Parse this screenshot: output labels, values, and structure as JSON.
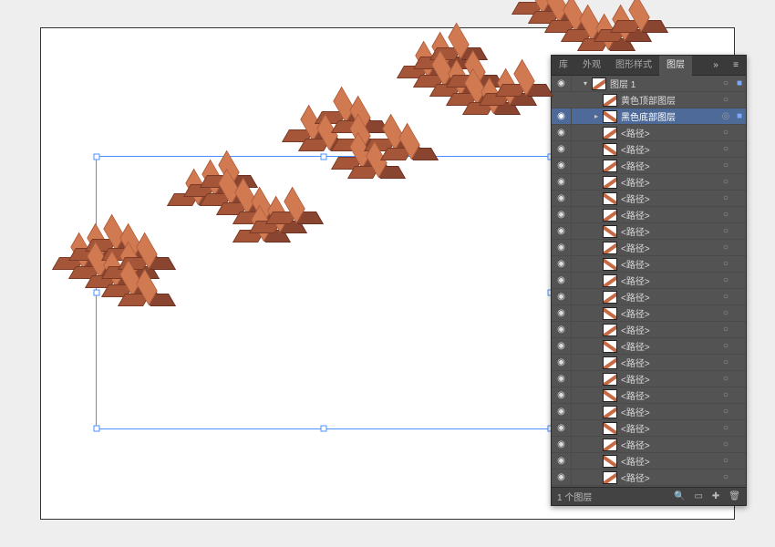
{
  "canvas_text": "PIXEL",
  "panel": {
    "tabs": [
      "库",
      "外观",
      "图形样式",
      "图层"
    ],
    "active_tab": "图层",
    "menu_glyph": "»",
    "hamburger_glyph": "≡",
    "top_layer": {
      "name": "图层 1",
      "expanded": true
    },
    "sublayers": [
      {
        "name": "黄色顶部图层",
        "visible": false,
        "selected": false,
        "thumb": "a"
      },
      {
        "name": "黑色底部图层",
        "visible": true,
        "selected": true,
        "thumb": "b"
      },
      {
        "name": "<路径>",
        "visible": true,
        "selected": false,
        "thumb": "a"
      },
      {
        "name": "<路径>",
        "visible": true,
        "selected": false,
        "thumb": "b"
      },
      {
        "name": "<路径>",
        "visible": true,
        "selected": false,
        "thumb": "a"
      },
      {
        "name": "<路径>",
        "visible": true,
        "selected": false,
        "thumb": "a"
      },
      {
        "name": "<路径>",
        "visible": true,
        "selected": false,
        "thumb": "b"
      },
      {
        "name": "<路径>",
        "visible": true,
        "selected": false,
        "thumb": "a"
      },
      {
        "name": "<路径>",
        "visible": true,
        "selected": false,
        "thumb": "b"
      },
      {
        "name": "<路径>",
        "visible": true,
        "selected": false,
        "thumb": "a"
      },
      {
        "name": "<路径>",
        "visible": true,
        "selected": false,
        "thumb": "b"
      },
      {
        "name": "<路径>",
        "visible": true,
        "selected": false,
        "thumb": "a"
      },
      {
        "name": "<路径>",
        "visible": true,
        "selected": false,
        "thumb": "a"
      },
      {
        "name": "<路径>",
        "visible": true,
        "selected": false,
        "thumb": "b"
      },
      {
        "name": "<路径>",
        "visible": true,
        "selected": false,
        "thumb": "a"
      },
      {
        "name": "<路径>",
        "visible": true,
        "selected": false,
        "thumb": "b"
      },
      {
        "name": "<路径>",
        "visible": true,
        "selected": false,
        "thumb": "a"
      },
      {
        "name": "<路径>",
        "visible": true,
        "selected": false,
        "thumb": "a"
      },
      {
        "name": "<路径>",
        "visible": true,
        "selected": false,
        "thumb": "b"
      },
      {
        "name": "<路径>",
        "visible": true,
        "selected": false,
        "thumb": "a"
      },
      {
        "name": "<路径>",
        "visible": true,
        "selected": false,
        "thumb": "b"
      },
      {
        "name": "<路径>",
        "visible": true,
        "selected": false,
        "thumb": "a"
      },
      {
        "name": "<路径>",
        "visible": true,
        "selected": false,
        "thumb": "b"
      },
      {
        "name": "<路径>",
        "visible": true,
        "selected": false,
        "thumb": "a"
      }
    ],
    "footer": {
      "count_label": "1 个图层",
      "icons": [
        "search-icon",
        "new-sublayer-icon",
        "new-layer-icon",
        "trash-icon"
      ]
    }
  },
  "glyphs": {
    "eye": "◉",
    "disclosure_open": "▾",
    "disclosure_right": "▸",
    "target": "○",
    "target_sel": "◎",
    "selbox": "■",
    "search": "🔍",
    "newlayer": "✚",
    "newsub": "▭",
    "trash": "🗑"
  },
  "letters": {
    "P": [
      [
        0,
        0
      ],
      [
        1,
        0
      ],
      [
        2,
        0
      ],
      [
        0,
        1
      ],
      [
        2,
        1
      ],
      [
        0,
        2
      ],
      [
        1,
        2
      ],
      [
        2,
        2
      ],
      [
        0,
        3
      ],
      [
        0,
        4
      ]
    ],
    "I": [
      [
        0,
        0
      ],
      [
        1,
        0
      ],
      [
        2,
        0
      ],
      [
        1,
        1
      ],
      [
        1,
        2
      ],
      [
        1,
        3
      ],
      [
        0,
        4
      ],
      [
        1,
        4
      ],
      [
        2,
        4
      ]
    ],
    "X": [
      [
        0,
        0
      ],
      [
        2,
        0
      ],
      [
        0,
        1
      ],
      [
        2,
        1
      ],
      [
        1,
        2
      ],
      [
        0,
        3
      ],
      [
        2,
        3
      ],
      [
        0,
        4
      ],
      [
        2,
        4
      ]
    ],
    "E": [
      [
        0,
        0
      ],
      [
        1,
        0
      ],
      [
        2,
        0
      ],
      [
        0,
        1
      ],
      [
        0,
        2
      ],
      [
        1,
        2
      ],
      [
        0,
        3
      ],
      [
        0,
        4
      ],
      [
        1,
        4
      ],
      [
        2,
        4
      ]
    ],
    "L": [
      [
        0,
        0
      ],
      [
        0,
        1
      ],
      [
        0,
        2
      ],
      [
        0,
        3
      ],
      [
        0,
        4
      ],
      [
        1,
        4
      ],
      [
        2,
        4
      ]
    ]
  }
}
